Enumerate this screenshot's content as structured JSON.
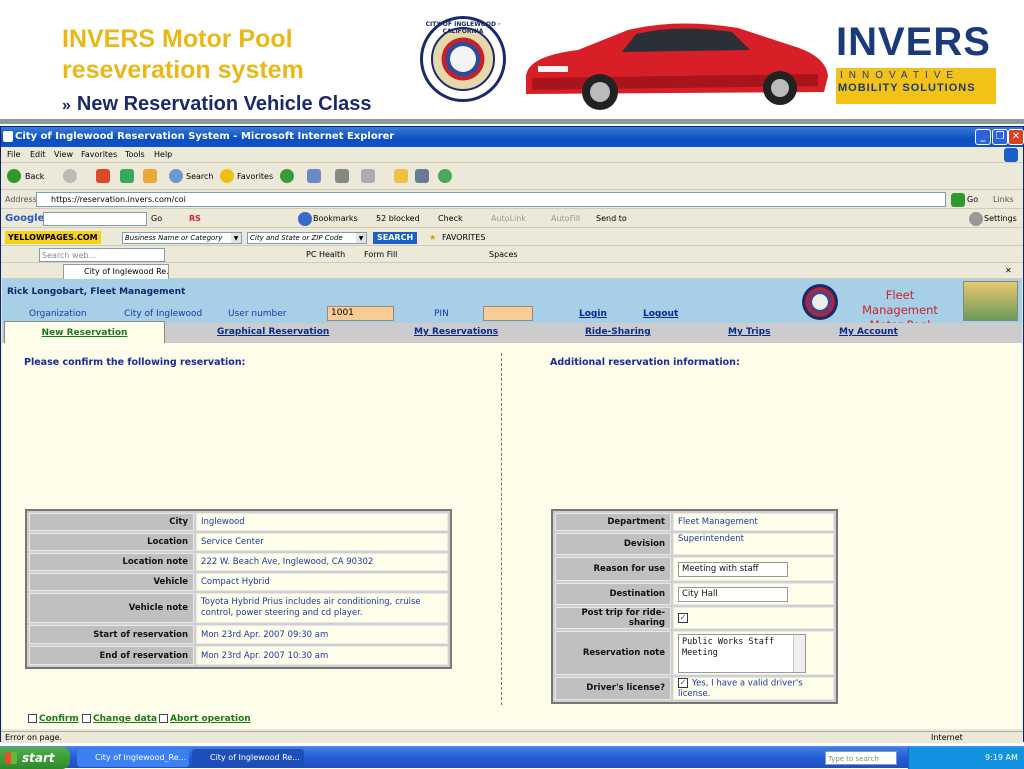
{
  "slide": {
    "title_line1": "INVERS Motor Pool",
    "title_line2": "reseveration system",
    "arrow": "»",
    "subtitle": "New Reservation Vehicle Class",
    "logo_big": "INVERS",
    "logo_line1": "INNOVATIVE",
    "logo_line2": "MOBILITY SOLUTIONS",
    "seal_text": "CITY OF INGLEWOOD · CALIFORNIA"
  },
  "browser": {
    "title": "City of Inglewood Reservation System - Microsoft Internet Explorer",
    "menu": [
      "File",
      "Edit",
      "View",
      "Favorites",
      "Tools",
      "Help"
    ],
    "toolbar": {
      "back": "Back",
      "search": "Search",
      "favorites": "Favorites"
    },
    "address_label": "Address",
    "address_value": "https://reservation.invers.com/coi",
    "go": "Go",
    "links": "Links",
    "google": {
      "go": "Go",
      "bookmarks": "Bookmarks",
      "blocked": "52 blocked",
      "check": "Check",
      "autolink": "AutoLink",
      "autofill": "AutoFill",
      "sendto": "Send to",
      "settings": "Settings"
    },
    "yp": {
      "logo": "YELLOWPAGES.COM",
      "business_placeholder": "Business Name or Category",
      "city_placeholder": "City and State or ZIP Code",
      "search": "SEARCH",
      "favorites": "FAVORITES"
    },
    "live": {
      "search_placeholder": "Search web...",
      "pc_health": "PC Health",
      "form_fill": "Form Fill",
      "spaces": "Spaces"
    },
    "tab_title": "City of Inglewood Re...",
    "status_left": "Error on page.",
    "status_right": "Internet"
  },
  "app": {
    "user": "Rick Longobart, Fleet Management",
    "organization_label": "Organization",
    "organization_value": "City of Inglewood",
    "user_number_label": "User number",
    "user_number_value": "1001",
    "pin_label": "PIN",
    "pin_value": "",
    "login": "Login",
    "logout": "Logout",
    "fm_title_line1": "Fleet Management",
    "fm_title_line2": "Motor Pool",
    "tabs": [
      "New Reservation",
      "Graphical Reservation",
      "My Reservations",
      "Ride-Sharing",
      "My Trips",
      "My Account"
    ],
    "confirm_heading": "Please confirm the following reservation:",
    "additional_heading": "Additional reservation information:",
    "reservation": [
      {
        "label": "City",
        "value": "Inglewood"
      },
      {
        "label": "Location",
        "value": "Service Center"
      },
      {
        "label": "Location note",
        "value": "222 W. Beach Ave, Inglewood, CA 90302"
      },
      {
        "label": "Vehicle",
        "value": "Compact Hybrid"
      },
      {
        "label": "Vehicle note",
        "value": "Toyota Hybrid Prius includes air conditioning, cruise control, power steering and cd player."
      },
      {
        "label": "Start of reservation",
        "value": "Mon 23rd Apr. 2007 09:30 am"
      },
      {
        "label": "End of reservation",
        "value": "Mon 23rd Apr. 2007 10:30 am"
      }
    ],
    "additional": {
      "department_label": "Department",
      "department_value": "Fleet Management",
      "devision_label": "Devision",
      "devision_value": "Superintendent",
      "reason_label": "Reason for use",
      "reason_value": "Meeting with staff",
      "destination_label": "Destination",
      "destination_value": "City Hall",
      "post_label": "Post trip for ride-sharing",
      "note_label": "Reservation note",
      "note_value": "Public Works Staff Meeting",
      "license_label": "Driver's license?",
      "license_value": "Yes, I have a valid driver's license."
    },
    "actions": {
      "confirm": "Confirm",
      "change": "Change data",
      "abort": "Abort operation"
    }
  },
  "taskbar": {
    "start": "start",
    "items": [
      "City of Inglewood_Re...",
      "City of Inglewood Re..."
    ],
    "search_placeholder": "Type to search",
    "time": "9:19 AM"
  }
}
